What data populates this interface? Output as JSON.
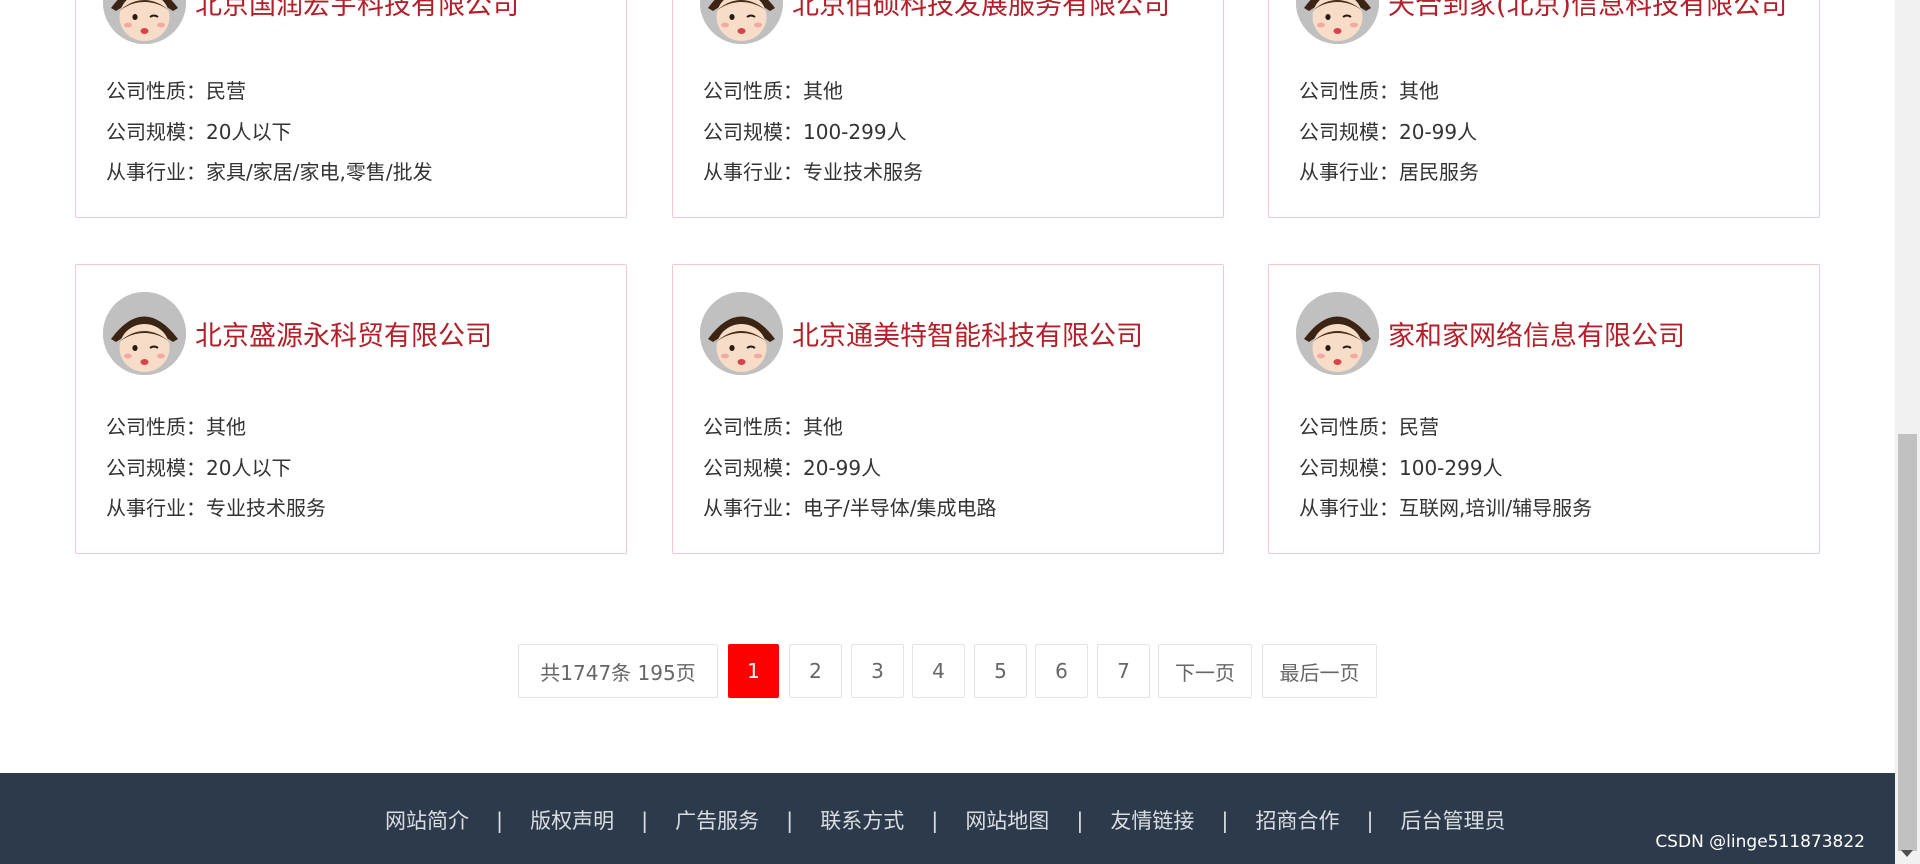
{
  "companies_row1": [
    {
      "name": "北京国润宏宇科技有限公司",
      "nature_label": "公司性质：",
      "nature": "民营",
      "scale_label": "公司规模：",
      "scale": "20人以下",
      "industry_label": "从事行业：",
      "industry": "家具/家居/家电,零售/批发"
    },
    {
      "name": "北京佰硕科技发展服务有限公司",
      "nature_label": "公司性质：",
      "nature": "其他",
      "scale_label": "公司规模：",
      "scale": "100-299人",
      "industry_label": "从事行业：",
      "industry": "专业技术服务"
    },
    {
      "name": "天合到家(北京)信息科技有限公司",
      "nature_label": "公司性质：",
      "nature": "其他",
      "scale_label": "公司规模：",
      "scale": "20-99人",
      "industry_label": "从事行业：",
      "industry": "居民服务"
    }
  ],
  "companies_row2": [
    {
      "name": "北京盛源永科贸有限公司",
      "nature_label": "公司性质：",
      "nature": "其他",
      "scale_label": "公司规模：",
      "scale": "20人以下",
      "industry_label": "从事行业：",
      "industry": "专业技术服务"
    },
    {
      "name": "北京通美特智能科技有限公司",
      "nature_label": "公司性质：",
      "nature": "其他",
      "scale_label": "公司规模：",
      "scale": "20-99人",
      "industry_label": "从事行业：",
      "industry": "电子/半导体/集成电路"
    },
    {
      "name": "家和家网络信息有限公司",
      "nature_label": "公司性质：",
      "nature": "民营",
      "scale_label": "公司规模：",
      "scale": "100-299人",
      "industry_label": "从事行业：",
      "industry": "互联网,培训/辅导服务"
    }
  ],
  "pagination": {
    "summary": "共1747条  195页",
    "pages": [
      "1",
      "2",
      "3",
      "4",
      "5",
      "6",
      "7"
    ],
    "current": "1",
    "next": "下一页",
    "last": "最后一页"
  },
  "footer": {
    "links": [
      "网站简介",
      "版权声明",
      "广告服务",
      "联系方式",
      "网站地图",
      "友情链接",
      "招商合作",
      "后台管理员"
    ],
    "separator": "|"
  },
  "watermark": "CSDN @linge511873822",
  "icons": {
    "avatar": "cartoon-avatar-icon",
    "scroll_down": "chevron-down-icon"
  },
  "colors": {
    "accent": "#ff0000",
    "company_name": "#b3202a",
    "footer_bg": "#2c3a4b",
    "card_border": "#f2c9cf"
  }
}
